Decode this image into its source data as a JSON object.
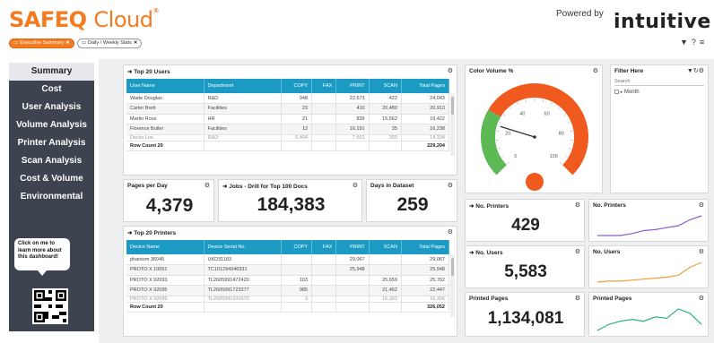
{
  "header": {
    "logo_main": "SAFEQ",
    "logo_cloud": "Cloud",
    "logo_mark": "®",
    "tabs": [
      {
        "label": "Executive Summary",
        "icon": "folder-icon",
        "active": true
      },
      {
        "label": "Daily / Weekly Stats",
        "icon": "folder-icon",
        "active": false
      }
    ],
    "powered_by": "Powered by",
    "brand": "intuitive",
    "tools": [
      "filter-icon",
      "help-icon",
      "menu-icon"
    ]
  },
  "sidebar": {
    "items": [
      "Summary",
      "Cost",
      "User Analysis",
      "Volume Analysis",
      "Printer Analysis",
      "Scan Analysis",
      "Cost & Volume",
      "Environmental"
    ],
    "selected": "Summary",
    "promo": "Click on me to learn more about this dashboard!"
  },
  "top_users": {
    "title": "Top 20 Users",
    "columns": [
      "User Name",
      "Department",
      "COPY",
      "FAX",
      "PRINT",
      "SCAN",
      "Total Pages"
    ],
    "rows": [
      [
        "Wade Douglas",
        "R&D",
        "948",
        "",
        "22,673",
        "422",
        "24,043"
      ],
      [
        "Carter Brett",
        "Facilities",
        "23",
        "",
        "410",
        "20,480",
        "20,913"
      ],
      [
        "Martin Ross",
        "HR",
        "21",
        "",
        "839",
        "15,562",
        "16,422"
      ],
      [
        "Florence Butler",
        "Facilities",
        "12",
        "",
        "16,191",
        "35",
        "16,238"
      ],
      [
        "Decks Lee",
        "R&D",
        "6,404",
        "",
        "7,601",
        "300",
        "14,334"
      ]
    ],
    "footer": [
      "Row Count 20",
      "",
      "",
      "",
      "",
      "",
      "229,204"
    ]
  },
  "kpis": {
    "pages_per_day": {
      "title": "Pages per Day",
      "value": "4,379"
    },
    "jobs": {
      "title": "Jobs - Drill for Top 100 Docs",
      "value": "184,383"
    },
    "days": {
      "title": "Days in Dataset",
      "value": "259"
    }
  },
  "top_printers": {
    "title": "Top 20 Printers",
    "columns": [
      "Device Name",
      "Device Serial No.",
      "COPY",
      "FAX",
      "PRINT",
      "SCAN",
      "Total Pages"
    ],
    "rows": [
      [
        "phantom 36045",
        "UKD31183",
        "",
        "",
        "29,067",
        "",
        "29,067"
      ],
      [
        "PROTO X 10051",
        "TC101294346931",
        "",
        "",
        "25,948",
        "",
        "25,948"
      ],
      [
        "PROTO X 92093",
        "TL2605991472420",
        "103",
        "",
        "",
        "25,659",
        "25,762"
      ],
      [
        "PROTO X 92095",
        "TL2605991723377",
        "985",
        "",
        "",
        "21,462",
        "22,447"
      ],
      [
        "PROTO X 92099",
        "TL2605991931070",
        "3",
        "",
        "",
        "16,303",
        "16,306"
      ]
    ],
    "footer": [
      "Row Count 20",
      "",
      "",
      "",
      "",
      "",
      "326,052"
    ]
  },
  "color_volume": {
    "title": "Color Volume %",
    "ticks": [
      "0",
      "20",
      "40",
      "60",
      "80",
      "100"
    ],
    "needle_value": 23,
    "colors": {
      "green": "#5db954",
      "orange": "#f05a1e"
    }
  },
  "filter": {
    "title": "Filter Here",
    "search_placeholder": "Search",
    "item": "Month"
  },
  "metrics": {
    "printers": {
      "title": "No. Printers",
      "value": "429",
      "spark_title": "No. Printers",
      "spark_color": "#8a5fc9",
      "spark": [
        4,
        4,
        4,
        4.2,
        4.5,
        4.6,
        4.8,
        5,
        5.6,
        6
      ]
    },
    "users": {
      "title": "No. Users",
      "value": "5,583",
      "spark_title": "No. Users",
      "spark_color": "#f39c3c",
      "spark": [
        2,
        2.1,
        2.1,
        2.2,
        2.3,
        2.4,
        2.5,
        2.7,
        3.5,
        4
      ]
    },
    "pages": {
      "title": "Printed Pages",
      "value": "1,134,081",
      "spark_title": "Printed Pages",
      "spark_color": "#2ab27b",
      "spark": [
        2,
        3,
        3.5,
        3.8,
        3.5,
        4.2,
        4.0,
        5.5,
        4.8,
        3
      ]
    }
  },
  "colors": {
    "accent": "#f47b20",
    "header_blue": "#1b9bc3",
    "sidebar": "#3d4450"
  }
}
